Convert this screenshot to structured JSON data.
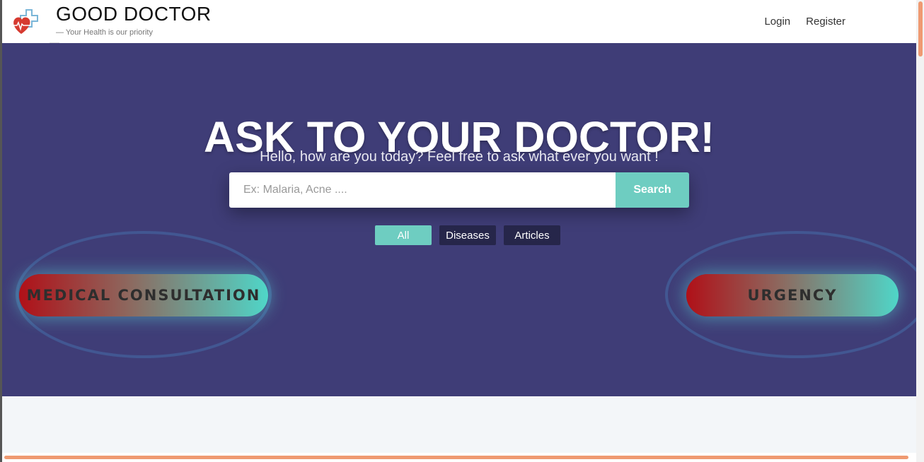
{
  "header": {
    "title": "GOOD DOCTOR",
    "subtitle": "— Your Health is our priority",
    "logo_icon": "heart-pulse-cross-icon",
    "nav": {
      "login": "Login",
      "register": "Register"
    }
  },
  "hero": {
    "title": "ASK TO YOUR DOCTOR!",
    "subtitle": "Hello, how are you today? Feel free to ask what ever you want !",
    "search": {
      "placeholder": "Ex: Malaria, Acne ....",
      "value": "",
      "button": "Search"
    },
    "filters": [
      {
        "label": "All",
        "active": true
      },
      {
        "label": "Diseases",
        "active": false
      },
      {
        "label": "Articles",
        "active": false
      }
    ],
    "buttons": {
      "consultation": "MEDICAL CONSULTATION",
      "urgency": "URGENCY"
    }
  },
  "colors": {
    "hero_bg": "#3f3d77",
    "accent": "#6ecdc1",
    "filter_bg": "#26264a",
    "scroll_thumb": "#ef9a72"
  }
}
